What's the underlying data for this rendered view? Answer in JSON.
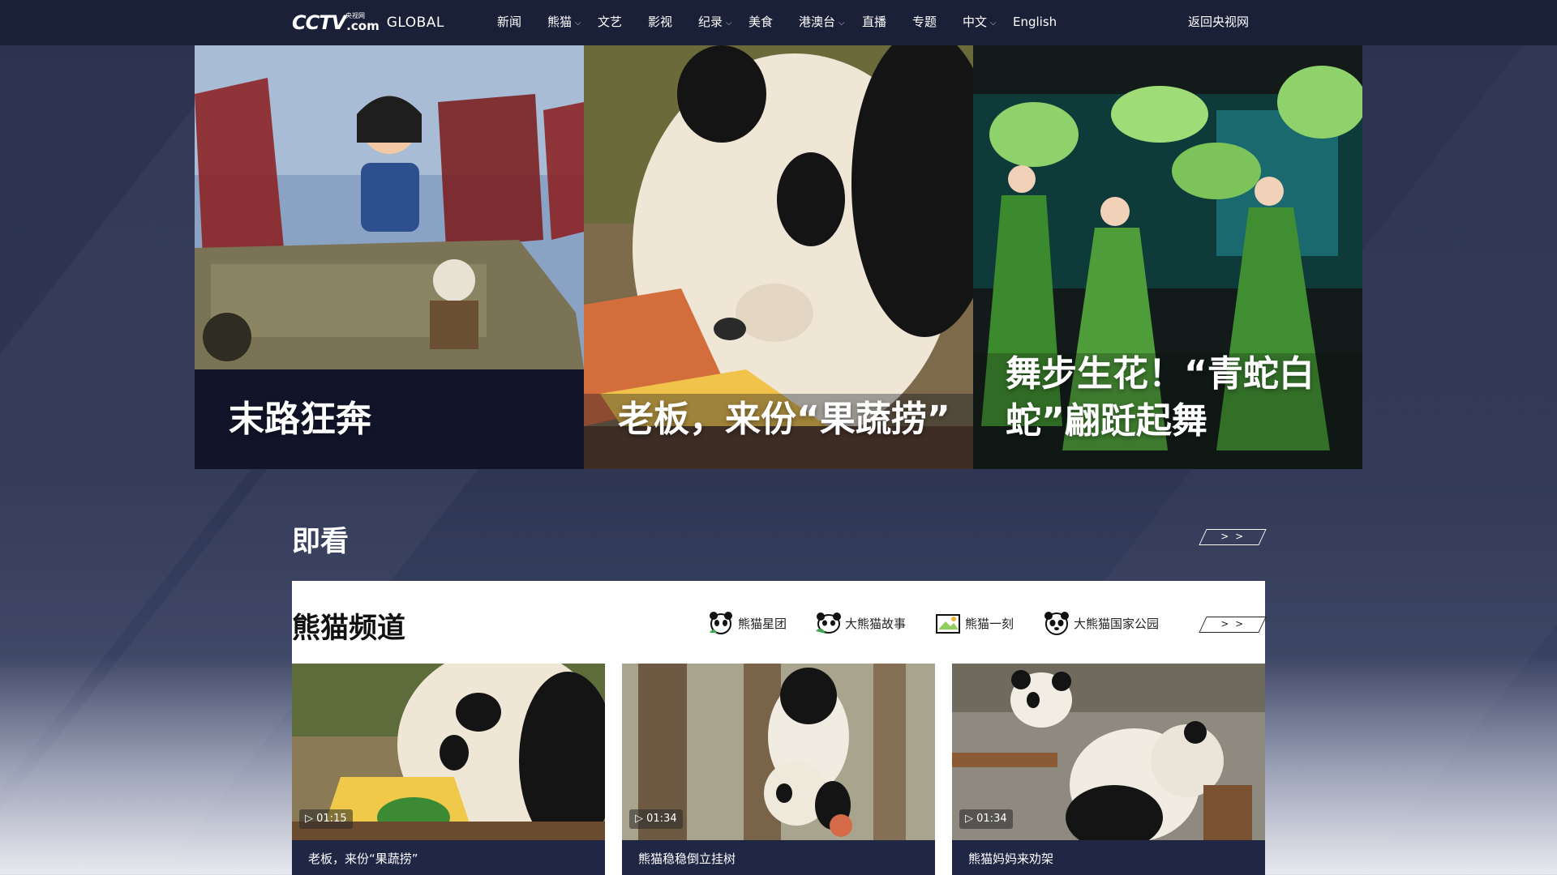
{
  "header": {
    "logo_mark": "CCTV",
    "logo_com": ".com",
    "logo_sub": "央视网",
    "logo_global": "GLOBAL",
    "nav": [
      {
        "label": "新闻",
        "dropdown": false
      },
      {
        "label": "熊猫",
        "dropdown": true
      },
      {
        "label": "文艺",
        "dropdown": false
      },
      {
        "label": "影视",
        "dropdown": false
      },
      {
        "label": "纪录",
        "dropdown": true
      },
      {
        "label": "美食",
        "dropdown": false
      },
      {
        "label": "港澳台",
        "dropdown": true
      },
      {
        "label": "直播",
        "dropdown": false
      },
      {
        "label": "专题",
        "dropdown": false
      },
      {
        "label": "中文",
        "dropdown": true
      },
      {
        "label": "English",
        "dropdown": false
      }
    ],
    "return_link": "返回央视网",
    "chevron_glyph": "⌵"
  },
  "hero": [
    {
      "title": "末路狂奔",
      "image": "caricature-jeep-image"
    },
    {
      "title": "老板，来份“果蔬捞”",
      "image": "panda-eating-image"
    },
    {
      "title": "舞步生花！“青蛇白蛇”翩跹起舞",
      "image": "green-fan-dancers-image"
    }
  ],
  "jikan": {
    "title": "即看",
    "more_label": "> >"
  },
  "panda_channel": {
    "title": "熊猫频道",
    "sub_nav": [
      {
        "label": "熊猫星团",
        "icon": "panda-face-icon"
      },
      {
        "label": "大熊猫故事",
        "icon": "panda-story-icon"
      },
      {
        "label": "熊猫一刻",
        "icon": "panda-photo-icon"
      },
      {
        "label": "大熊猫国家公园",
        "icon": "panda-park-icon"
      }
    ],
    "more_label": "> >",
    "videos": [
      {
        "duration": "01:15",
        "caption": "老板，来份“果蔬捞”",
        "play_glyph": "▷"
      },
      {
        "duration": "01:34",
        "caption": "熊猫稳稳倒立挂树",
        "play_glyph": "▷"
      },
      {
        "duration": "01:34",
        "caption": "熊猫妈妈来劝架",
        "play_glyph": "▷"
      }
    ]
  },
  "colors": {
    "nav_bg": "#1a2038",
    "page_bg": "#2e3654",
    "card_caption_bg": "#1f2745",
    "panel_bg": "#ffffff"
  }
}
